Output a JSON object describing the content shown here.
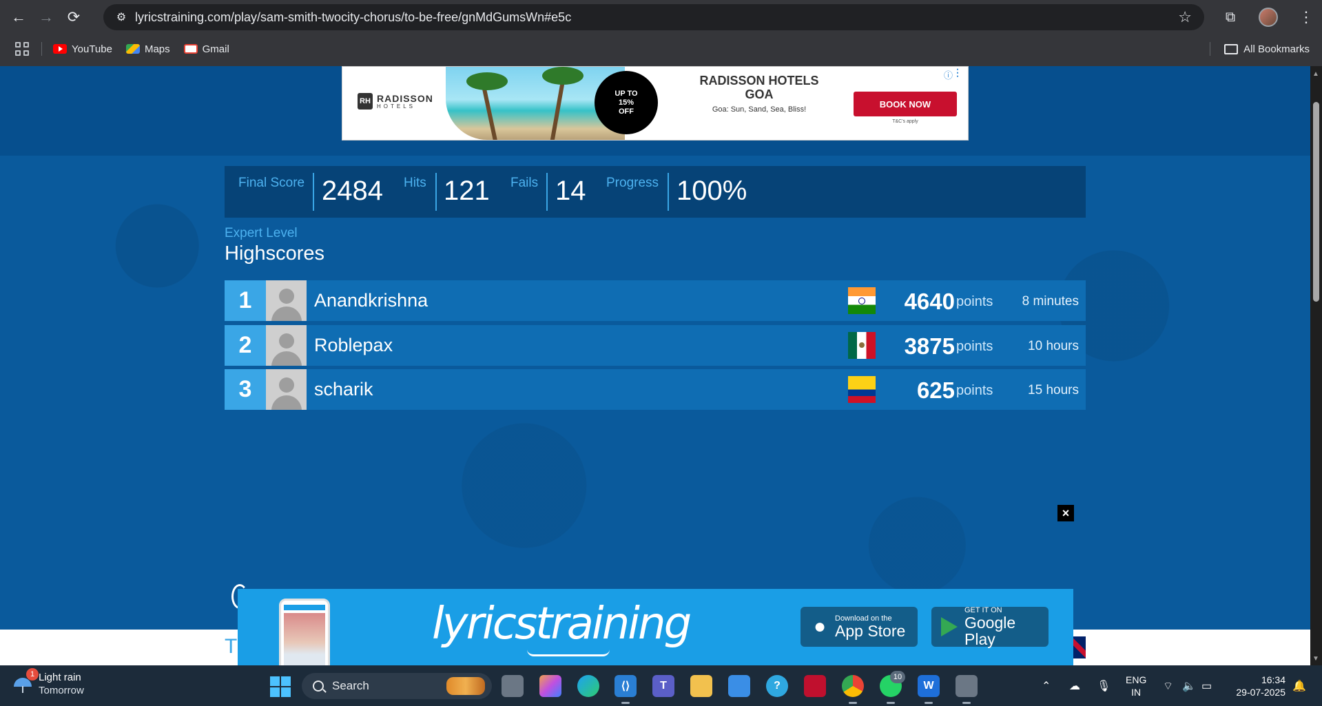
{
  "browser": {
    "url": "lyricstraining.com/play/sam-smith-twocity-chorus/to-be-free/gnMdGumsWn#e5c",
    "bookmarks": [
      "YouTube",
      "Maps",
      "Gmail"
    ],
    "all_bookmarks_label": "All Bookmarks"
  },
  "ad": {
    "brand": "RADISSON",
    "brand_sub": "HOTELS",
    "brand_mark": "RH",
    "badge_line1": "UP TO",
    "badge_line2": "15%",
    "badge_line3": "OFF",
    "headline": "RADISSON HOTELS GOA",
    "tagline": "Goa: Sun, Sand, Sea, Bliss!",
    "cta": "BOOK NOW",
    "terms": "T&C's apply"
  },
  "stats": {
    "final_score_label": "Final Score",
    "final_score": "2484",
    "hits_label": "Hits",
    "hits": "121",
    "fails_label": "Fails",
    "fails": "14",
    "progress_label": "Progress",
    "progress": "100%"
  },
  "highscores": {
    "level": "Expert Level",
    "title": "Highscores",
    "points_label": "points",
    "rows": [
      {
        "rank": "1",
        "name": "Anandkrishna",
        "flag": "india",
        "points": "4640",
        "time": "8 minutes"
      },
      {
        "rank": "2",
        "name": "Roblepax",
        "flag": "mexico",
        "points": "3875",
        "time": "10 hours"
      },
      {
        "rank": "3",
        "name": "scharik",
        "flag": "colombia",
        "points": "625",
        "time": "15 hours"
      }
    ]
  },
  "footer": {
    "partial_text": "T"
  },
  "app_banner": {
    "brand": "lyricstraining",
    "app_store_small": "Download on the",
    "app_store_big": "App Store",
    "google_small": "GET IT ON",
    "google_big": "Google Play",
    "close": "×"
  },
  "taskbar": {
    "weather_title": "Light rain",
    "weather_sub": "Tomorrow",
    "weather_badge": "1",
    "search_placeholder": "Search",
    "whatsapp_badge": "10",
    "lang_line1": "ENG",
    "lang_line2": "IN",
    "time": "16:34",
    "date": "29-07-2025"
  }
}
